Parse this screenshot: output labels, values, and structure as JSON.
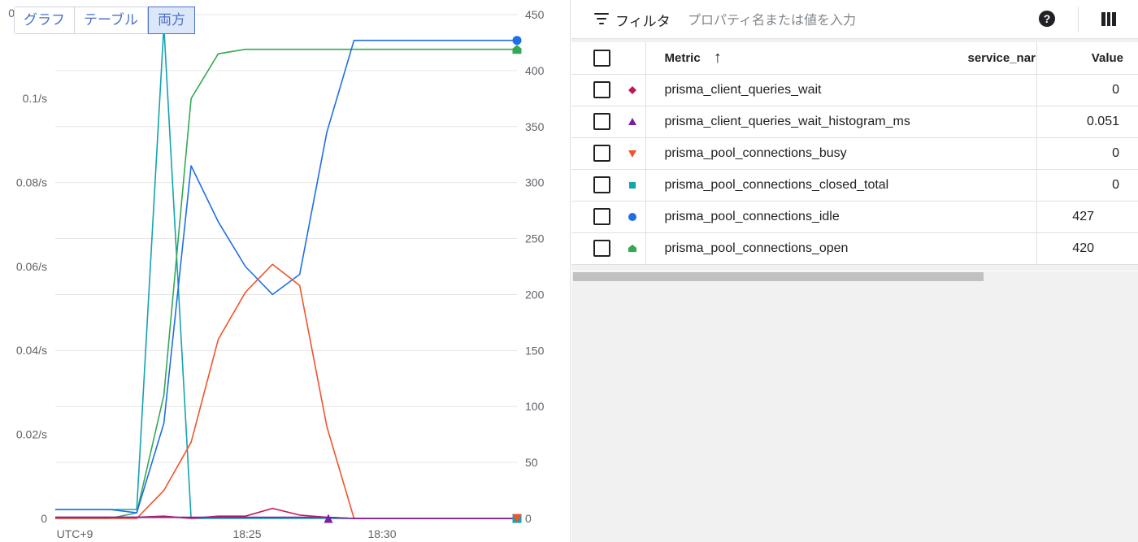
{
  "view_toggle": {
    "graph": "グラフ",
    "table": "テーブル",
    "both": "両方",
    "active": "both"
  },
  "chart_data": {
    "type": "line",
    "x_ticks": [
      "UTC+9",
      "18:25",
      "18:30"
    ],
    "left_axis": {
      "ticks": [
        "0",
        "0.02/s",
        "0.04/s",
        "0.06/s",
        "0.08/s",
        "0.1/s"
      ],
      "values": [
        0,
        0.02,
        0.04,
        0.06,
        0.08,
        0.1
      ],
      "top_label": "0"
    },
    "right_axis": {
      "ticks": [
        "0",
        "50",
        "100",
        "150",
        "200",
        "250",
        "300",
        "350",
        "400",
        "450"
      ],
      "values": [
        0,
        50,
        100,
        150,
        200,
        250,
        300,
        350,
        400,
        450
      ],
      "ylim": [
        0,
        450
      ]
    },
    "x": [
      0,
      1,
      2,
      3,
      4,
      5,
      6,
      7,
      8,
      9,
      10,
      11,
      12,
      13,
      14,
      15,
      16,
      17
    ],
    "series": [
      {
        "name": "prisma_pool_connections_closed_total",
        "color": "#12a4af",
        "marker": "square",
        "values": [
          8,
          8,
          8,
          8,
          440,
          0,
          0,
          0,
          0,
          0,
          0,
          0,
          0,
          0,
          0,
          0,
          0,
          0
        ]
      },
      {
        "name": "prisma_pool_connections_open",
        "color": "#34a853",
        "marker": "pentagon",
        "values": [
          0,
          0,
          0,
          5,
          110,
          375,
          415,
          419,
          419,
          419,
          419,
          419,
          419,
          419,
          419,
          419,
          419,
          419
        ]
      },
      {
        "name": "prisma_pool_connections_idle",
        "color": "#1f6ee8",
        "marker": "circle",
        "values": [
          8,
          8,
          8,
          5,
          85,
          315,
          265,
          225,
          200,
          218,
          345,
          427,
          427,
          427,
          427,
          427,
          427,
          427
        ]
      },
      {
        "name": "prisma_pool_connections_busy",
        "color": "#f0542d",
        "marker": "triangle-down",
        "values": [
          0,
          0,
          0,
          0,
          25,
          68,
          160,
          202,
          227,
          208,
          82,
          0,
          0,
          0,
          0,
          0,
          0,
          0
        ]
      },
      {
        "name": "prisma_client_queries_wait",
        "color": "#c2185b",
        "marker": "diamond",
        "values": [
          1,
          1,
          1,
          1,
          2,
          0,
          2,
          2,
          9,
          3,
          1,
          0,
          0,
          0,
          0,
          0,
          0,
          0
        ]
      },
      {
        "name": "prisma_client_queries_wait_histogram_ms",
        "color": "#7b1fa2",
        "marker": "triangle",
        "values": [
          1,
          1,
          1,
          1,
          1,
          1,
          1,
          1,
          1,
          1,
          1,
          0,
          0,
          0,
          0,
          0,
          0,
          0
        ]
      }
    ]
  },
  "filter": {
    "label": "フィルタ",
    "placeholder": "プロパティ名または値を入力"
  },
  "table": {
    "headers": {
      "metric": "Metric",
      "service": "service_nar",
      "value": "Value",
      "sort_icon": "arrow-up-icon"
    },
    "rows": [
      {
        "metric": "prisma_client_queries_wait",
        "value": "0",
        "color": "#c2185b",
        "marker": "diamond"
      },
      {
        "metric": "prisma_client_queries_wait_histogram_ms",
        "value": "0.051",
        "color": "#7b1fa2",
        "marker": "triangle"
      },
      {
        "metric": "prisma_pool_connections_busy",
        "value": "0",
        "color": "#f0542d",
        "marker": "triangle-down"
      },
      {
        "metric": "prisma_pool_connections_closed_total",
        "value": "0",
        "color": "#12a4af",
        "marker": "square"
      },
      {
        "metric": "prisma_pool_connections_idle",
        "value": "427",
        "color": "#1f6ee8",
        "marker": "circle"
      },
      {
        "metric": "prisma_pool_connections_open",
        "value": "420",
        "color": "#34a853",
        "marker": "pentagon"
      }
    ]
  }
}
